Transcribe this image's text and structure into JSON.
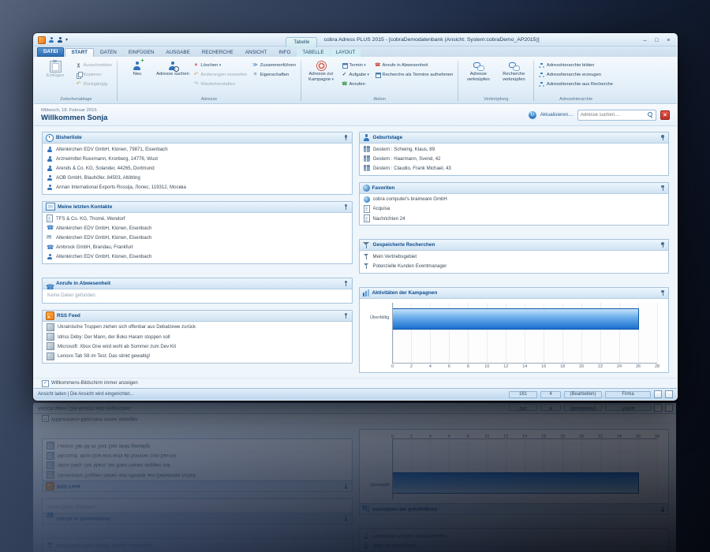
{
  "window": {
    "title": "cobra Adress PLUS 2015 - [cobraDemodatenbank (Ansicht: System:cobraDemo_AP2015)]",
    "contextual_group": "Tabelle",
    "controls": {
      "minimize": "–",
      "maximize": "□",
      "close": "×"
    }
  },
  "ribbon": {
    "tabs": [
      {
        "label": "DATEI",
        "type": "file"
      },
      {
        "label": "START",
        "type": "active"
      },
      {
        "label": "DATEN"
      },
      {
        "label": "EINFÜGEN"
      },
      {
        "label": "AUSGABE"
      },
      {
        "label": "RECHERCHE"
      },
      {
        "label": "ANSICHT"
      },
      {
        "label": "INFO"
      },
      {
        "label": "TABELLE",
        "type": "contextual"
      },
      {
        "label": "LAYOUT",
        "type": "contextual"
      }
    ],
    "buttons": {
      "einfuegen": "Einfügen",
      "ausschneiden": "Ausschneiden",
      "kopieren": "Kopieren",
      "rueckgaengig": "Rückgängig",
      "neu": "Neu",
      "adresse_suchen": "Adresse suchen",
      "loeschen": "Löschen",
      "aenderungen_verwerfen": "Änderungen verwerfen",
      "wiederherstellen": "Wiederherstellen",
      "zusammenfuehren": "Zusammenführen",
      "eigenschaften": "Eigenschaften",
      "adresse_zur_kampagne": "Adresse zur Kampagne",
      "termin": "Termin",
      "aufgabe": "Aufgabe",
      "anrufen": "Anrufen",
      "anrufe_in_abwesenheit": "Anrufe in Abwesenheit",
      "recherche_termine": "Recherche als Termine aufnehmen",
      "adresse_verknuepfen": "Adresse verknüpfen",
      "recherche_verknuepfen": "Recherche verknüpfen",
      "hierarchie_bilden": "Adresshierarchie bilden",
      "hierarchie_erzeugen": "Adresshierarchie erzeugen",
      "hierarchie_recherche": "Adresshierarchie aus Recherche"
    },
    "group_labels": [
      "Zwischenablage",
      "Adresse",
      "Aktion",
      "Verknüpfung",
      "Adresshierarchie"
    ]
  },
  "welcome": {
    "date": "Mittwoch, 18. Februar 2015",
    "greeting": "Willkommen Sonja",
    "refresh_icon": "↻",
    "refresh_label": "Aktualisieren....",
    "search_placeholder": "Adresse suchen....",
    "close_icon": "×"
  },
  "panels": {
    "bisherliste": {
      "title": "Bisherliste",
      "items": [
        {
          "icon": "person-blue",
          "text": "Altenkirchen EDV GmbH, Klonen, 79871, Eisenbach"
        },
        {
          "icon": "person-blue",
          "text": "Arzneimittel Ruexmann, Kronberg, 14776, Wust"
        },
        {
          "icon": "person-blue",
          "text": "Arends & Co. KG, Solander, 44265, Dortmund"
        },
        {
          "icon": "person-blue",
          "text": "AOB GmbH, Blauhöfer, 84503, Altötting"
        },
        {
          "icon": "person-blue",
          "text": "Annan International Exports Rossija, Лопес, 119312, Москва"
        }
      ]
    },
    "kontakte": {
      "title": "Meine letzten Kontakte",
      "items": [
        {
          "icon": "doc",
          "text": "TFS & Co. KG, Thomé, Wendorf"
        },
        {
          "icon": "phone-blue",
          "text": "Altenkirchen EDV GmbH, Klonen, Eisenbach"
        },
        {
          "icon": "mail-blue",
          "text": "Altenkirchen EDV GmbH, Klonen, Eisenbach"
        },
        {
          "icon": "phone-blue",
          "text": "Ambrock GmbH, Brandau, Frankfurt"
        },
        {
          "icon": "person-blue",
          "text": "Altenkirchen EDV GmbH, Klonen, Eisenbach"
        }
      ]
    },
    "anrufe": {
      "title": "Anrufe in Abwesenheit",
      "empty": "Keine Daten gefunden."
    },
    "rss": {
      "title": "RSS Feed",
      "items": [
        {
          "icon": "img",
          "text": "Ukrainische Truppen ziehen sich offenbar aus Debalzewe zurück"
        },
        {
          "icon": "img",
          "text": "Idriss Déby: Der Mann, der Boko Haram stoppen soll"
        },
        {
          "icon": "img",
          "text": "Microsoft: Xbox One wird wohl ab Sommer zum Dev Kit"
        },
        {
          "icon": "img",
          "text": "Lenovo Tab S8 im Test: Das stinkt gewaltig!"
        }
      ]
    },
    "geburtstage": {
      "title": "Geburtstage",
      "items": [
        {
          "icon": "gift",
          "text": "Gestern : Schwing, Klaus, 89"
        },
        {
          "icon": "gift",
          "text": "Gestern : Haarmann, Svend, 42"
        },
        {
          "icon": "gift",
          "text": "Gestern : Claudio, Frank Michael, 43"
        }
      ]
    },
    "favoriten": {
      "title": "Favoriten",
      "items": [
        {
          "icon": "globe-sm",
          "text": "cobra computer's brainware GmbH"
        },
        {
          "icon": "doc",
          "text": "Acquisa"
        },
        {
          "icon": "doc",
          "text": "Nachrichten 24"
        }
      ]
    },
    "recherchen": {
      "title": "Gespeicherte Recherchen",
      "items": [
        {
          "icon": "funnel-sm",
          "text": "Mein Vertriebsgebiet"
        },
        {
          "icon": "funnel-sm",
          "text": "Potenzielle Kunden Eventmanager"
        }
      ]
    },
    "kampagnen": {
      "title": "Aktivitäten der Kampagnen"
    }
  },
  "chart_data": {
    "type": "bar",
    "orientation": "horizontal",
    "title": "Aktivitäten der Kampagnen",
    "categories": [
      "Überfällig"
    ],
    "values": [
      26
    ],
    "xlabel": "",
    "ylabel": "",
    "xlim": [
      0,
      28
    ],
    "xticks": [
      0,
      2,
      4,
      6,
      8,
      10,
      12,
      14,
      16,
      18,
      20,
      22,
      24,
      26,
      28
    ],
    "grid": true,
    "legend": false,
    "bar_color": "#1a6fd0"
  },
  "footer": {
    "checkbox_label": "Willkommens-Bildschirm immer anzeigen",
    "checked": true,
    "check_glyph": "✓"
  },
  "statusbar": {
    "left": "Ansicht laden | Die Ansicht wird eingerichtet...",
    "cells": [
      "161",
      "4",
      "(Bearbeiten)",
      "Firma"
    ]
  },
  "colors": {
    "accent": "#2f74bd",
    "bar": "#1a6fd0",
    "rss_orange": "#f07d12",
    "close_red": "#bf3024",
    "panel_header_text": "#0f4c8c"
  }
}
